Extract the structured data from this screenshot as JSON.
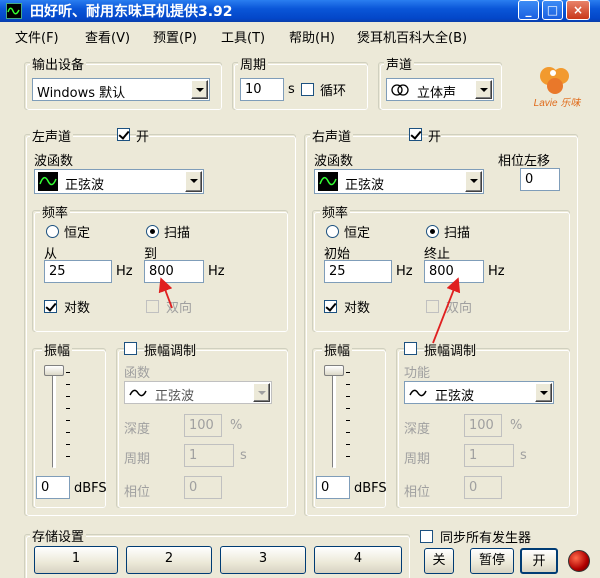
{
  "window": {
    "title": "田好听、耐用东味耳机提供3.92",
    "minimize": "_",
    "maximize": "□",
    "close": "×"
  },
  "menu": [
    "文件(F)",
    "查看(V)",
    "预置(P)",
    "工具(T)",
    "帮助(H)",
    "煲耳机百科大全(B)"
  ],
  "output": {
    "label": "输出设备",
    "device": "Windows 默认"
  },
  "period": {
    "label": "周期",
    "value": "10",
    "unit": "s",
    "loop_label": "循环",
    "loop_checked": false
  },
  "channel": {
    "label": "声道",
    "value": "立体声"
  },
  "logo": {
    "text": "Lavie 乐味"
  },
  "left": {
    "label": "左声道",
    "enabled_label": "开",
    "enabled": true,
    "waveform_label": "波函数",
    "waveform": "正弦波",
    "freq_label": "频率",
    "fixed_label": "恒定",
    "sweep_label": "扫描",
    "from_label": "从",
    "from_value": "25",
    "to_label": "到",
    "to_value": "800",
    "unit": "Hz",
    "log_label": "对数",
    "bidir_label": "双向",
    "amp_label": "振幅",
    "amp_value": "0",
    "amp_unit": "dBFS",
    "mod_label": "振幅调制",
    "mod_func_label": "函数",
    "mod_func": "正弦波",
    "depth_label": "深度",
    "depth_value": "100",
    "depth_unit": "%",
    "period_label": "周期",
    "period_value": "1",
    "period_unit": "s",
    "phase_label": "相位",
    "phase_value": "0"
  },
  "right": {
    "label": "右声道",
    "enabled_label": "开",
    "enabled": true,
    "waveform_label": "波函数",
    "waveform": "正弦波",
    "phase_shift_label": "相位左移",
    "phase_shift_value": "0",
    "freq_label": "频率",
    "fixed_label": "恒定",
    "sweep_label": "扫描",
    "from_label": "初始",
    "from_value": "25",
    "to_label": "终止",
    "to_value": "800",
    "unit": "Hz",
    "log_label": "对数",
    "bidir_label": "双向",
    "amp_label": "振幅",
    "amp_value": "0",
    "amp_unit": "dBFS",
    "mod_label": "振幅调制",
    "mod_func_label": "功能",
    "mod_func": "正弦波",
    "depth_label": "深度",
    "depth_value": "100",
    "depth_unit": "%",
    "period_label": "周期",
    "period_value": "1",
    "period_unit": "s",
    "phase_label": "相位",
    "phase_value": "0"
  },
  "storage": {
    "label": "存储设置",
    "buttons": [
      "1",
      "2",
      "3",
      "4"
    ]
  },
  "sync_label": "同步所有发生器",
  "controls": {
    "off": "关",
    "pause": "暂停",
    "on": "开"
  },
  "colors": {
    "accent_red": "#e02020",
    "titlebar": "#0a56d8"
  }
}
